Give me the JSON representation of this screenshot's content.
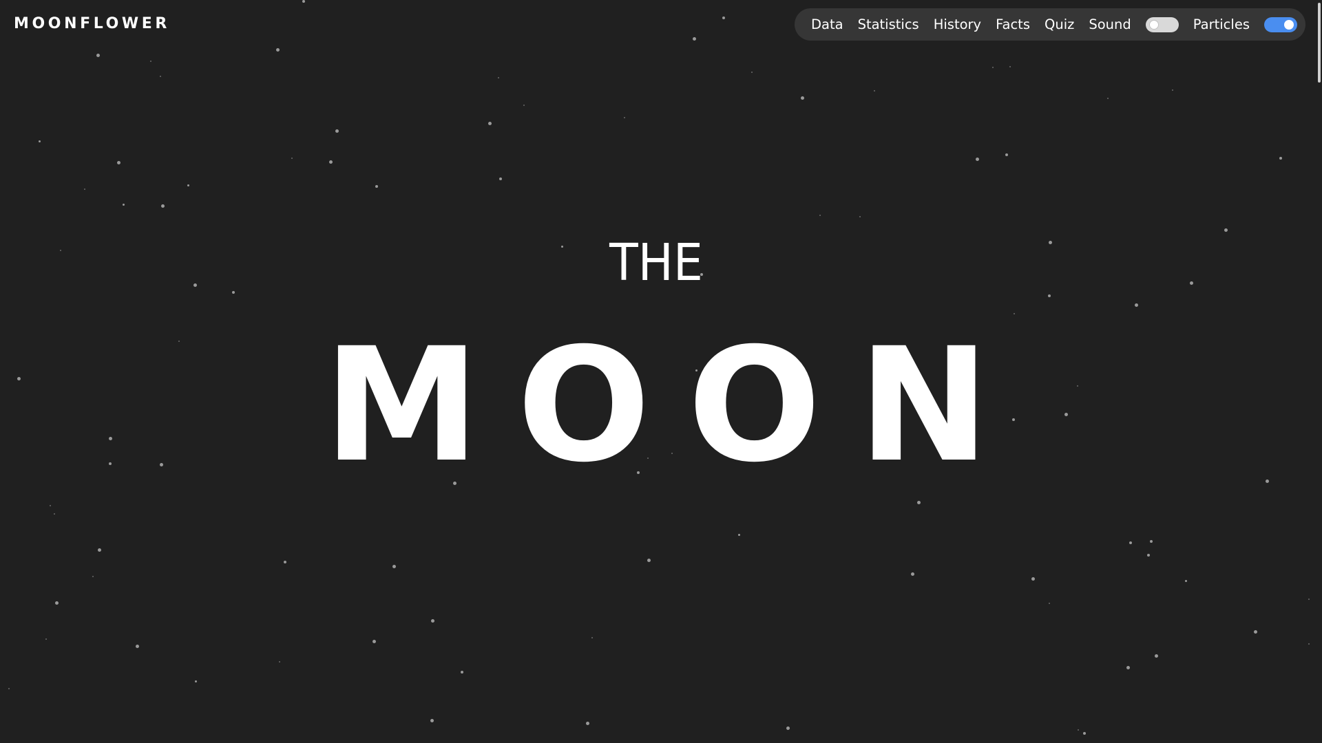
{
  "brand": {
    "name": "MOONFLOWER"
  },
  "nav": {
    "links": [
      "Data",
      "Statistics",
      "History",
      "Facts",
      "Quiz"
    ],
    "sound_label": "Sound",
    "sound_enabled": false,
    "particles_label": "Particles",
    "particles_enabled": true
  },
  "hero": {
    "kicker": "THE",
    "title": "MOON"
  },
  "colors": {
    "background": "#202020",
    "nav_pill": "#363636",
    "toggle_on": "#4a8ef0",
    "toggle_off": "#d9d9d9",
    "text": "#ffffff",
    "star": "#9a9a9a"
  }
}
